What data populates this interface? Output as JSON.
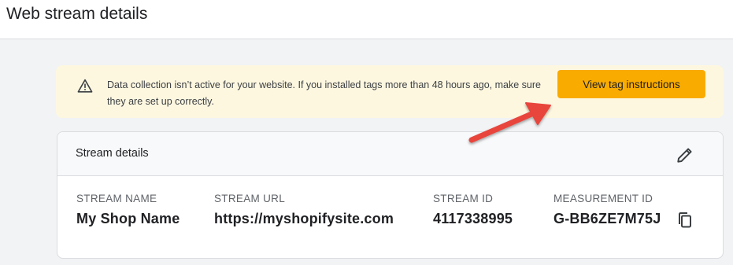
{
  "page": {
    "title": "Web stream details"
  },
  "banner": {
    "icon": "warning-icon",
    "message": "Data collection isn’t active for your website. If you installed tags more than 48 hours ago, make sure they are set up correctly.",
    "button_label": "View tag instructions"
  },
  "stream_details": {
    "title": "Stream details",
    "edit_icon": "pencil-icon",
    "copy_icon": "copy-icon",
    "fields": [
      {
        "label": "STREAM NAME",
        "value": "My Shop Name"
      },
      {
        "label": "STREAM URL",
        "value": "https://myshopifysite.com"
      },
      {
        "label": "STREAM ID",
        "value": "4117338995"
      },
      {
        "label": "MEASUREMENT ID",
        "value": "G-BB6ZE7M75J"
      }
    ]
  },
  "colors": {
    "banner_bg": "#fef7e0",
    "button_bg": "#f9ab00",
    "annotation_arrow": "#e8453c"
  }
}
